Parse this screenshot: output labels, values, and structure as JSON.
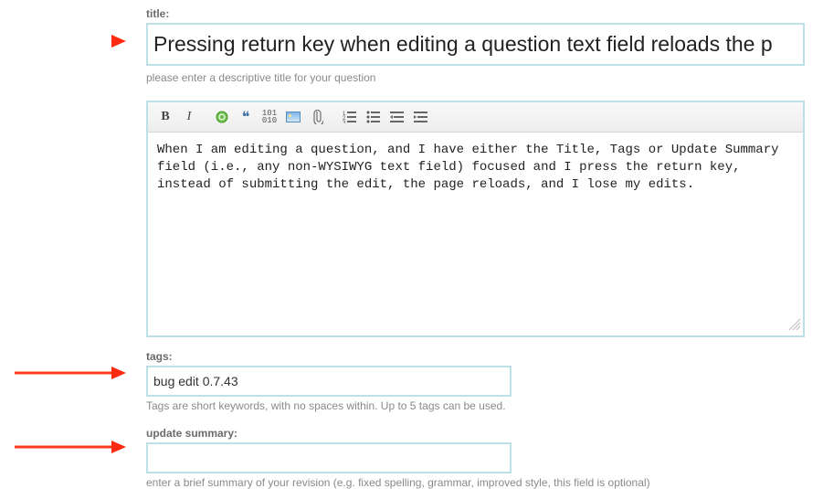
{
  "title": {
    "label": "title:",
    "value": "Pressing return key when editing a question text field reloads the p",
    "hint": "please enter a descriptive title for your question"
  },
  "toolbar": {
    "bold": "B",
    "italic": "I",
    "link": "link-icon",
    "quote": "❝",
    "code": "code-icon",
    "image": "image-icon",
    "attach": "attach-icon",
    "olist": "ordered-list-icon",
    "ulist": "unordered-list-icon",
    "outdent": "outdent-icon",
    "indent": "indent-icon"
  },
  "body": {
    "value": "When I am editing a question, and I have either the Title, Tags or Update Summary field (i.e., any non-WYSIWYG text field) focused and I press the return key, instead of submitting the edit, the page reloads, and I lose my edits."
  },
  "tags": {
    "label": "tags:",
    "value": "bug edit 0.7.43",
    "hint": "Tags are short keywords, with no spaces within. Up to 5 tags can be used."
  },
  "update_summary": {
    "label": "update summary:",
    "value": "",
    "hint": "enter a brief summary of your revision (e.g. fixed spelling, grammar, improved style, this field is optional)"
  }
}
